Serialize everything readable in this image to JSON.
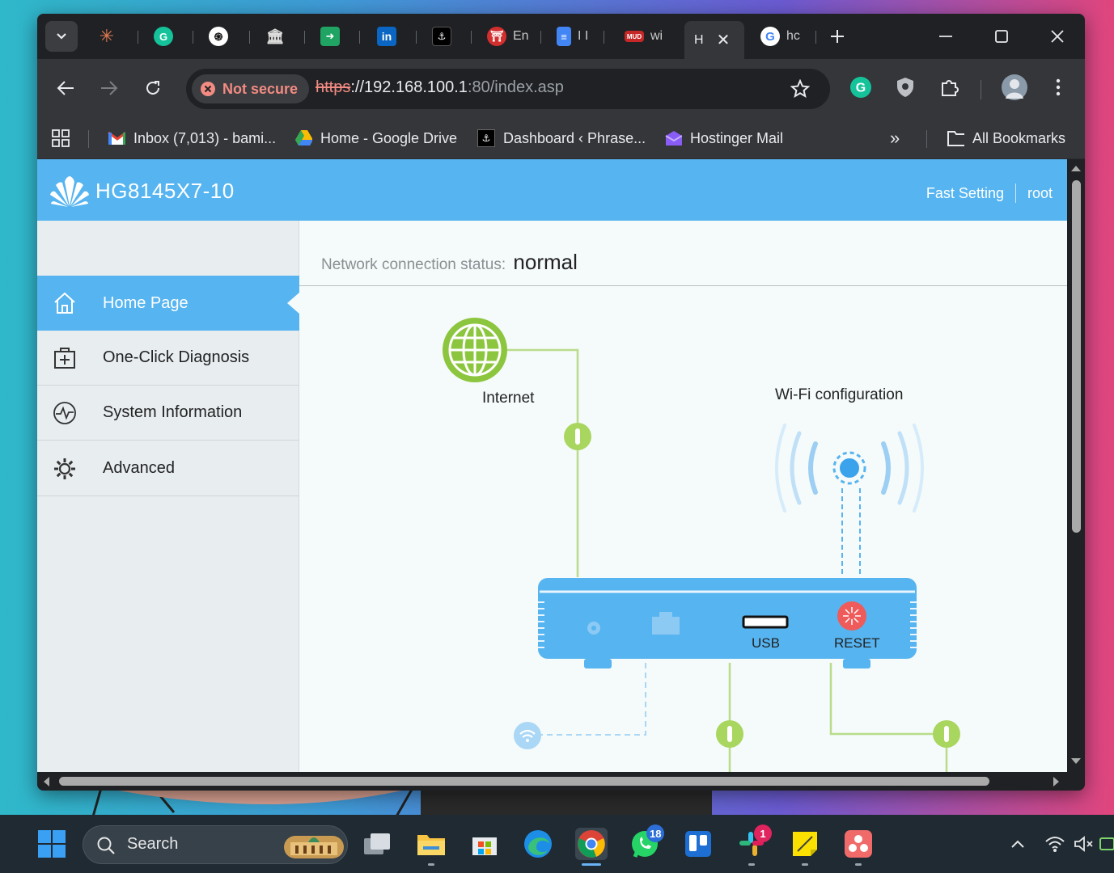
{
  "browser": {
    "tabs": [
      {
        "name": "tab-claude",
        "label": ""
      },
      {
        "name": "tab-grammarly",
        "label": ""
      },
      {
        "name": "tab-chatgpt",
        "label": ""
      },
      {
        "name": "tab-pillar",
        "label": ""
      },
      {
        "name": "tab-sheets",
        "label": ""
      },
      {
        "name": "tab-linkedin",
        "label": ""
      },
      {
        "name": "tab-phrase",
        "label": ""
      },
      {
        "name": "tab-en",
        "label": "En"
      },
      {
        "name": "tab-docs",
        "label": "I I"
      },
      {
        "name": "tab-wi",
        "label": "wi"
      },
      {
        "name": "tab-active",
        "label": "H"
      },
      {
        "name": "tab-google",
        "label": "hc"
      }
    ],
    "security_chip": "Not secure",
    "url": {
      "scheme": "https",
      "host": "://192.168.100.1",
      "path": ":80/index.asp"
    },
    "bookmarks": [
      {
        "label": "Inbox (7,013) - bami..."
      },
      {
        "label": "Home - Google Drive"
      },
      {
        "label": "Dashboard ‹ Phrase..."
      },
      {
        "label": "Hostinger Mail"
      }
    ],
    "all_bookmarks": "All Bookmarks"
  },
  "router": {
    "model": "HG8145X7-10",
    "header_links": {
      "fast_setting": "Fast Setting",
      "user": "root"
    },
    "nav": [
      {
        "label": "Home Page",
        "icon": "home-icon",
        "active": true
      },
      {
        "label": "One-Click Diagnosis",
        "icon": "medical-kit-icon",
        "active": false
      },
      {
        "label": "System Information",
        "icon": "pulse-icon",
        "active": false
      },
      {
        "label": "Advanced",
        "icon": "gear-icon",
        "active": false
      }
    ],
    "status_label": "Network connection status:",
    "status_value": "normal",
    "diagram": {
      "internet_label": "Internet",
      "wifi_label": "Wi-Fi configuration",
      "usb_label": "USB",
      "reset_label": "RESET"
    }
  },
  "taskbar": {
    "search_placeholder": "Search",
    "whatsapp_badge": "18",
    "slack_badge": "1"
  },
  "colors": {
    "router_blue": "#56b4f0",
    "diagram_green": "#8cc63f",
    "line_green": "#b8dc8a",
    "reset_red": "#ef5a5a"
  }
}
